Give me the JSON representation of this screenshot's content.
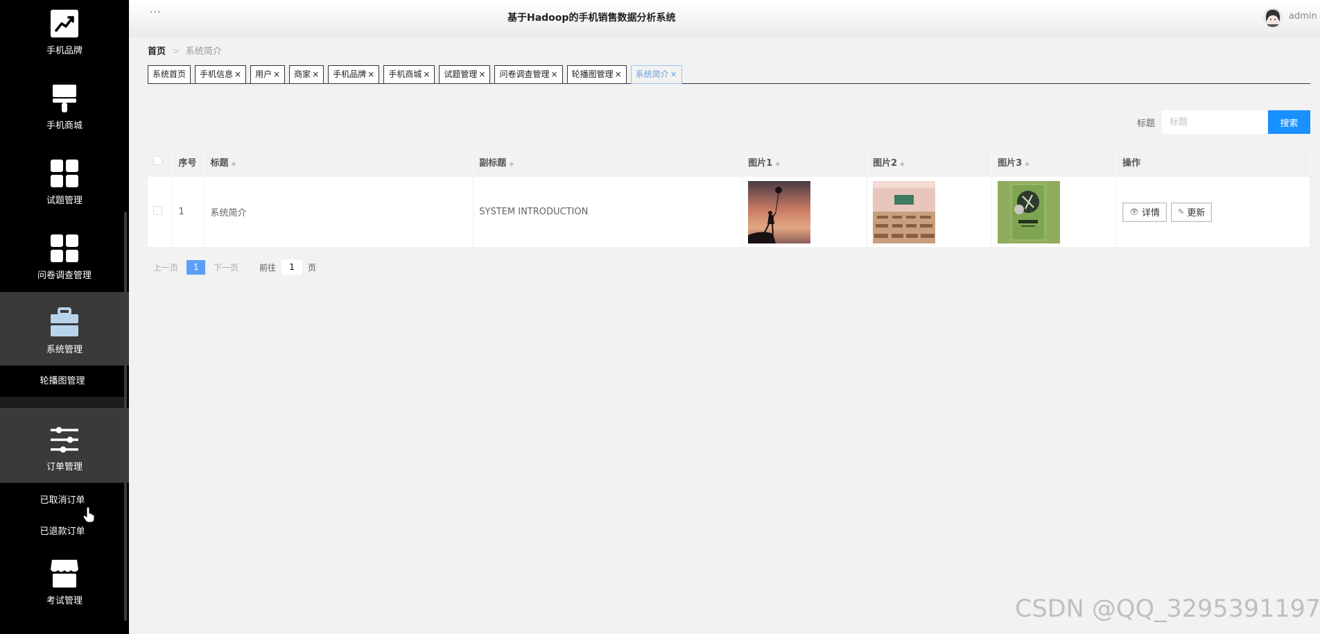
{
  "header": {
    "title": "基于Hadoop的手机销售数据分析系统",
    "more_icon": "more-dots-icon",
    "more": "···",
    "user": "admin"
  },
  "sidebar": {
    "items": [
      {
        "label": "手机品牌",
        "icon": "trend-chart-icon"
      },
      {
        "label": "手机商城",
        "icon": "brush-icon"
      },
      {
        "label": "试题管理",
        "icon": "grid-icon"
      },
      {
        "label": "问卷调查管理",
        "icon": "grid-icon"
      },
      {
        "label": "系统管理",
        "icon": "briefcase-icon",
        "active": true
      },
      {
        "label": "订单管理",
        "icon": "sliders-icon",
        "active": true
      },
      {
        "label": "考试管理",
        "icon": "shop-icon"
      }
    ],
    "system_sub": [
      "轮播图管理"
    ],
    "order_sub": [
      "已取消订单",
      "已退款订单"
    ]
  },
  "breadcrumb": {
    "home": "首页",
    "separator": ">",
    "current": "系统简介"
  },
  "tabs": [
    {
      "label": "系统首页",
      "closable": false
    },
    {
      "label": "手机信息",
      "closable": true
    },
    {
      "label": "用户",
      "closable": true
    },
    {
      "label": "商家",
      "closable": true
    },
    {
      "label": "手机品牌",
      "closable": true
    },
    {
      "label": "手机商城",
      "closable": true
    },
    {
      "label": "试题管理",
      "closable": true
    },
    {
      "label": "问卷调查管理",
      "closable": true
    },
    {
      "label": "轮播图管理",
      "closable": true
    },
    {
      "label": "系统简介",
      "closable": true,
      "active": true
    }
  ],
  "tab_close": "×",
  "search": {
    "label": "标题",
    "placeholder": "标题",
    "button": "搜索"
  },
  "table": {
    "columns": {
      "index": "序号",
      "title": "标题",
      "subtitle": "副标题",
      "pic1": "图片1",
      "pic2": "图片2",
      "pic3": "图片3",
      "actions": "操作"
    },
    "rows": [
      {
        "index": "1",
        "title": "系统简介",
        "subtitle": "SYSTEM INTRODUCTION",
        "detail": "详情",
        "update": "更新"
      }
    ]
  },
  "pagination": {
    "prev": "上一页",
    "current": "1",
    "next": "下一页",
    "goto": "前往",
    "goto_value": "1",
    "unit": "页"
  },
  "watermark": "CSDN @QQ_3295391197",
  "colors": {
    "primary": "#1890ff",
    "sidebar_bg": "#000000",
    "active_menu_bg": "#3a3a3a",
    "page_bg": "#f2f2f1"
  }
}
